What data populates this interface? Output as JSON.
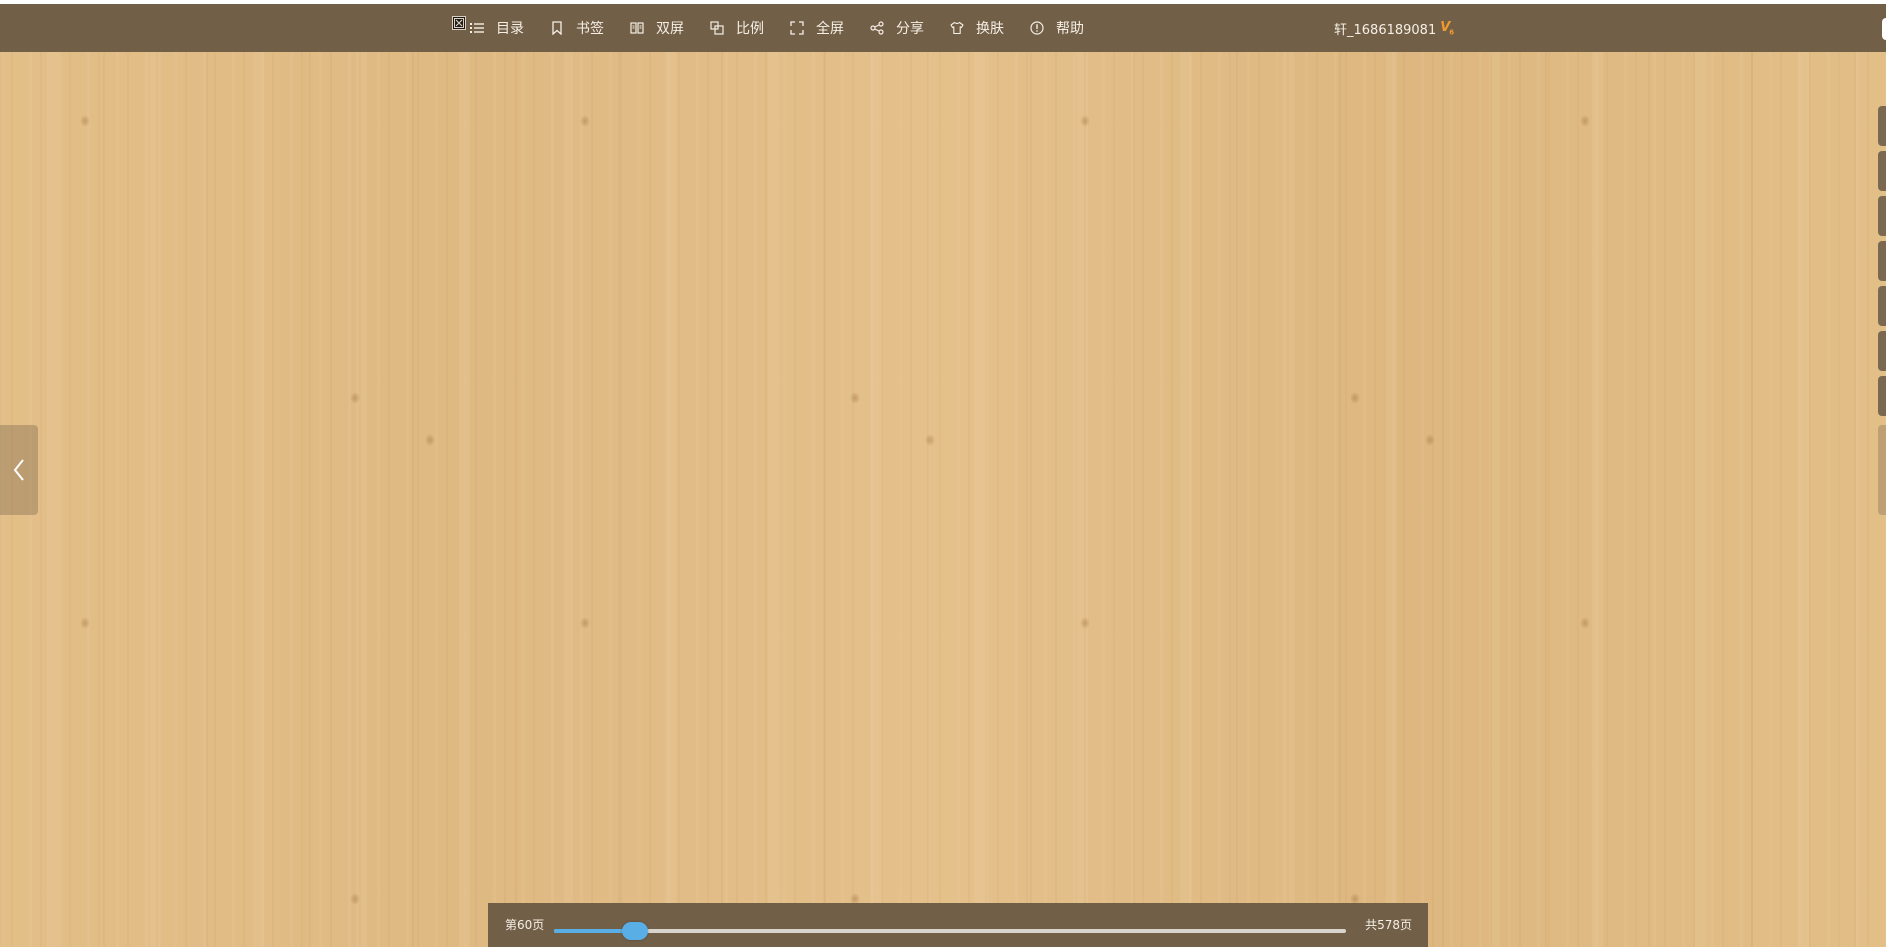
{
  "toolbar": {
    "items": [
      {
        "name": "toc",
        "label": "目录",
        "icon": "list-icon"
      },
      {
        "name": "bookmark",
        "label": "书签",
        "icon": "bookmark-icon"
      },
      {
        "name": "dual-screen",
        "label": "双屏",
        "icon": "dual-page-icon"
      },
      {
        "name": "ratio",
        "label": "比例",
        "icon": "ratio-icon"
      },
      {
        "name": "fullscreen",
        "label": "全屏",
        "icon": "fullscreen-icon"
      },
      {
        "name": "share",
        "label": "分享",
        "icon": "share-icon"
      },
      {
        "name": "skin",
        "label": "换肤",
        "icon": "shirt-icon"
      },
      {
        "name": "help",
        "label": "帮助",
        "icon": "info-icon"
      }
    ]
  },
  "user": {
    "name": "轩_1686189081",
    "vip_badge": "V",
    "vip_level": "6"
  },
  "pager": {
    "current_label": "第60页",
    "total_label": "共578页",
    "current_page": 60,
    "total_pages": 578
  },
  "colors": {
    "toolbar_bg": "#725f47",
    "wood_bg": "#e2bd86",
    "slider_accent": "#5aaee6",
    "vip_orange": "#f29a2e"
  }
}
